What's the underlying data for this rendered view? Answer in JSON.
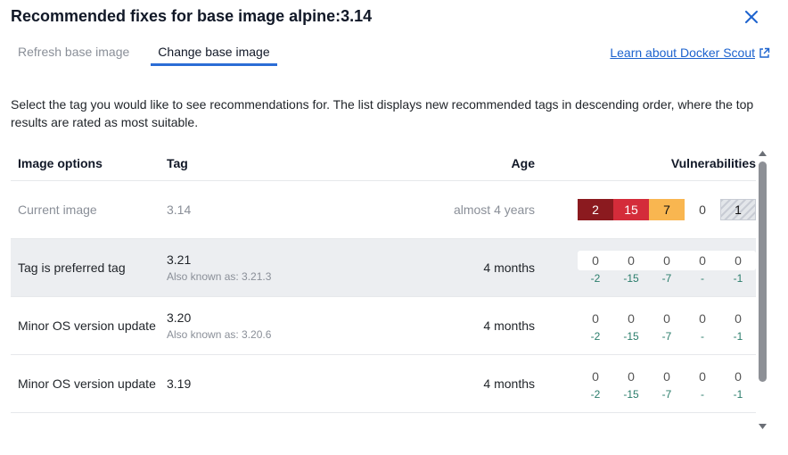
{
  "dialog": {
    "title": "Recommended fixes for base image alpine:3.14",
    "close_icon": "close-icon"
  },
  "tabs": [
    {
      "label": "Refresh base image",
      "active": false
    },
    {
      "label": "Change base image",
      "active": true
    }
  ],
  "learn_link": {
    "label": "Learn about Docker Scout",
    "icon": "external-link-icon"
  },
  "description": "Select the tag you would like to see recommendations for. The list displays new recommended tags in descending order, where the top results are rated as most suitable.",
  "table": {
    "headers": {
      "options": "Image options",
      "tag": "Tag",
      "age": "Age",
      "vulnerabilities": "Vulnerabilities"
    },
    "current": {
      "option": "Current image",
      "tag": "3.14",
      "age": "almost 4 years",
      "vulns": {
        "critical": "2",
        "high": "15",
        "medium": "7",
        "low": "0",
        "unspecified": "1"
      }
    },
    "rows": [
      {
        "option": "Tag is preferred tag",
        "tag": "3.21",
        "aka": "Also known as: 3.21.3",
        "age": "4 months",
        "counts": [
          "0",
          "0",
          "0",
          "0",
          "0"
        ],
        "deltas": [
          "-2",
          "-15",
          "-7",
          "-",
          "-1"
        ]
      },
      {
        "option": "Minor OS version update",
        "tag": "3.20",
        "aka": "Also known as: 3.20.6",
        "age": "4 months",
        "counts": [
          "0",
          "0",
          "0",
          "0",
          "0"
        ],
        "deltas": [
          "-2",
          "-15",
          "-7",
          "-",
          "-1"
        ]
      },
      {
        "option": "Minor OS version update",
        "tag": "3.19",
        "aka": "",
        "age": "4 months",
        "counts": [
          "0",
          "0",
          "0",
          "0",
          "0"
        ],
        "deltas": [
          "-2",
          "-15",
          "-7",
          "-",
          "-1"
        ]
      }
    ]
  },
  "colors": {
    "critical": "#8b1a1f",
    "high": "#d42c3a",
    "medium": "#f9b650",
    "accent": "#2b6dd6",
    "link": "#1d63ce",
    "delta": "#2a7d6b"
  }
}
